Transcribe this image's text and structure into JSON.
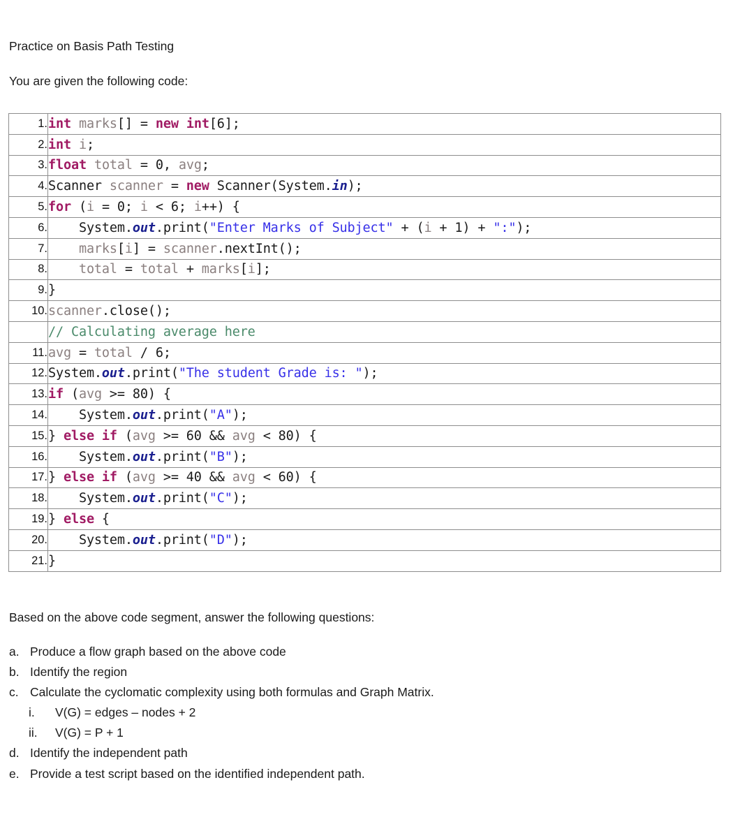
{
  "document": {
    "title": "Practice on Basis Path Testing",
    "intro": "You are given the following code:",
    "questions_intro": "Based on the above code segment, answer the following questions:"
  },
  "colors": {
    "keyword": "#a01a63",
    "identifier": "#8a7f7f",
    "string": "#3730e8",
    "field": "#1a1f8f",
    "comment": "#4a8a6a",
    "plain": "#1a1a1a",
    "table_border": "#8d8d8d",
    "page_background": "#ffffff"
  },
  "code_table": {
    "rows": [
      {
        "number": "1.",
        "tokens": [
          {
            "t": "int",
            "c": "kw"
          },
          {
            "t": " ",
            "c": "pl"
          },
          {
            "t": "marks",
            "c": "id"
          },
          {
            "t": "[] = ",
            "c": "pl"
          },
          {
            "t": "new",
            "c": "kw"
          },
          {
            "t": " ",
            "c": "pl"
          },
          {
            "t": "int",
            "c": "kw"
          },
          {
            "t": "[6];",
            "c": "pl"
          }
        ]
      },
      {
        "number": "2.",
        "tokens": [
          {
            "t": "int",
            "c": "kw"
          },
          {
            "t": " ",
            "c": "pl"
          },
          {
            "t": "i",
            "c": "id"
          },
          {
            "t": ";",
            "c": "pl"
          }
        ]
      },
      {
        "number": "3.",
        "tokens": [
          {
            "t": "float",
            "c": "kw"
          },
          {
            "t": " ",
            "c": "pl"
          },
          {
            "t": "total",
            "c": "id"
          },
          {
            "t": " = ",
            "c": "pl"
          },
          {
            "t": "0",
            "c": "pl"
          },
          {
            "t": ", ",
            "c": "pl"
          },
          {
            "t": "avg",
            "c": "id"
          },
          {
            "t": ";",
            "c": "pl"
          }
        ]
      },
      {
        "number": "4.",
        "tokens": [
          {
            "t": "Scanner ",
            "c": "pl"
          },
          {
            "t": "scanner",
            "c": "id"
          },
          {
            "t": " = ",
            "c": "pl"
          },
          {
            "t": "new",
            "c": "kw"
          },
          {
            "t": " Scanner(System.",
            "c": "pl"
          },
          {
            "t": "in",
            "c": "fld"
          },
          {
            "t": ");",
            "c": "pl"
          }
        ]
      },
      {
        "number": "5.",
        "tokens": [
          {
            "t": "for",
            "c": "kw"
          },
          {
            "t": " (",
            "c": "pl"
          },
          {
            "t": "i",
            "c": "id"
          },
          {
            "t": " = 0; ",
            "c": "pl"
          },
          {
            "t": "i",
            "c": "id"
          },
          {
            "t": " < 6; ",
            "c": "pl"
          },
          {
            "t": "i",
            "c": "id"
          },
          {
            "t": "++) {",
            "c": "pl"
          }
        ]
      },
      {
        "number": "6.",
        "indent": 2,
        "tokens": [
          {
            "t": "System.",
            "c": "pl"
          },
          {
            "t": "out",
            "c": "fld"
          },
          {
            "t": ".print(",
            "c": "pl"
          },
          {
            "t": "\"Enter Marks of Subject\"",
            "c": "str"
          },
          {
            "t": " + (",
            "c": "pl"
          },
          {
            "t": "i",
            "c": "id"
          },
          {
            "t": " + 1) + ",
            "c": "pl"
          },
          {
            "t": "\":\"",
            "c": "str"
          },
          {
            "t": ");",
            "c": "pl"
          }
        ]
      },
      {
        "number": "7.",
        "indent": 2,
        "tokens": [
          {
            "t": "marks",
            "c": "id"
          },
          {
            "t": "[",
            "c": "pl"
          },
          {
            "t": "i",
            "c": "id"
          },
          {
            "t": "] = ",
            "c": "pl"
          },
          {
            "t": "scanner",
            "c": "id"
          },
          {
            "t": ".nextInt();",
            "c": "pl"
          }
        ]
      },
      {
        "number": "8.",
        "indent": 2,
        "tokens": [
          {
            "t": "total",
            "c": "id"
          },
          {
            "t": " = ",
            "c": "pl"
          },
          {
            "t": "total",
            "c": "id"
          },
          {
            "t": " + ",
            "c": "pl"
          },
          {
            "t": "marks",
            "c": "id"
          },
          {
            "t": "[",
            "c": "pl"
          },
          {
            "t": "i",
            "c": "id"
          },
          {
            "t": "];",
            "c": "pl"
          }
        ]
      },
      {
        "number": "9.",
        "tokens": [
          {
            "t": "}",
            "c": "pl"
          }
        ]
      },
      {
        "number": "10.",
        "tokens": [
          {
            "t": "scanner",
            "c": "id"
          },
          {
            "t": ".close();",
            "c": "pl"
          }
        ]
      },
      {
        "number": "",
        "tokens": [
          {
            "t": "// Calculating average here",
            "c": "cmt"
          }
        ]
      },
      {
        "number": "11.",
        "tokens": [
          {
            "t": "avg",
            "c": "id"
          },
          {
            "t": " = ",
            "c": "pl"
          },
          {
            "t": "total",
            "c": "id"
          },
          {
            "t": " / 6;",
            "c": "pl"
          }
        ]
      },
      {
        "number": "12.",
        "tokens": [
          {
            "t": "System.",
            "c": "pl"
          },
          {
            "t": "out",
            "c": "fld"
          },
          {
            "t": ".print(",
            "c": "pl"
          },
          {
            "t": "\"The student Grade is: \"",
            "c": "str"
          },
          {
            "t": ");",
            "c": "pl"
          }
        ]
      },
      {
        "number": "13.",
        "tokens": [
          {
            "t": "if",
            "c": "kw"
          },
          {
            "t": " (",
            "c": "pl"
          },
          {
            "t": "avg",
            "c": "id"
          },
          {
            "t": " >= 80) {",
            "c": "pl"
          }
        ]
      },
      {
        "number": "14.",
        "indent": 2,
        "tokens": [
          {
            "t": "System.",
            "c": "pl"
          },
          {
            "t": "out",
            "c": "fld"
          },
          {
            "t": ".print(",
            "c": "pl"
          },
          {
            "t": "\"A\"",
            "c": "str"
          },
          {
            "t": ");",
            "c": "pl"
          }
        ]
      },
      {
        "number": "15.",
        "tokens": [
          {
            "t": "} ",
            "c": "pl"
          },
          {
            "t": "else if",
            "c": "kw"
          },
          {
            "t": " (",
            "c": "pl"
          },
          {
            "t": "avg",
            "c": "id"
          },
          {
            "t": " >= 60 && ",
            "c": "pl"
          },
          {
            "t": "avg",
            "c": "id"
          },
          {
            "t": " < 80) {",
            "c": "pl"
          }
        ]
      },
      {
        "number": "16.",
        "indent": 2,
        "tokens": [
          {
            "t": "System.",
            "c": "pl"
          },
          {
            "t": "out",
            "c": "fld"
          },
          {
            "t": ".print(",
            "c": "pl"
          },
          {
            "t": "\"B\"",
            "c": "str"
          },
          {
            "t": ");",
            "c": "pl"
          }
        ]
      },
      {
        "number": "17.",
        "tokens": [
          {
            "t": "} ",
            "c": "pl"
          },
          {
            "t": "else if",
            "c": "kw"
          },
          {
            "t": " (",
            "c": "pl"
          },
          {
            "t": "avg",
            "c": "id"
          },
          {
            "t": " >= 40 && ",
            "c": "pl"
          },
          {
            "t": "avg",
            "c": "id"
          },
          {
            "t": " < 60) {",
            "c": "pl"
          }
        ]
      },
      {
        "number": "18.",
        "indent": 2,
        "tokens": [
          {
            "t": "System.",
            "c": "pl"
          },
          {
            "t": "out",
            "c": "fld"
          },
          {
            "t": ".print(",
            "c": "pl"
          },
          {
            "t": "\"C\"",
            "c": "str"
          },
          {
            "t": ");",
            "c": "pl"
          }
        ]
      },
      {
        "number": "19.",
        "tokens": [
          {
            "t": "} ",
            "c": "pl"
          },
          {
            "t": "else",
            "c": "kw"
          },
          {
            "t": " {",
            "c": "pl"
          }
        ]
      },
      {
        "number": "20.",
        "indent": 2,
        "tokens": [
          {
            "t": "System.",
            "c": "pl"
          },
          {
            "t": "out",
            "c": "fld"
          },
          {
            "t": ".print(",
            "c": "pl"
          },
          {
            "t": "\"D\"",
            "c": "str"
          },
          {
            "t": ");",
            "c": "pl"
          }
        ]
      },
      {
        "number": "21.",
        "tokens": [
          {
            "t": "}",
            "c": "pl"
          }
        ]
      }
    ]
  },
  "questions": [
    {
      "marker": "a.",
      "text": "Produce a flow graph based on the above code"
    },
    {
      "marker": "b.",
      "text": "Identify the region"
    },
    {
      "marker": "c.",
      "text": "Calculate the cyclomatic complexity using both formulas and Graph Matrix.",
      "sub": [
        {
          "marker": "i.",
          "text": "V(G) = edges – nodes + 2"
        },
        {
          "marker": "ii.",
          "text": "V(G) = P + 1"
        }
      ]
    },
    {
      "marker": "d.",
      "text": "Identify the independent path"
    },
    {
      "marker": "e.",
      "text": "Provide a test script based on the identified independent path."
    }
  ]
}
